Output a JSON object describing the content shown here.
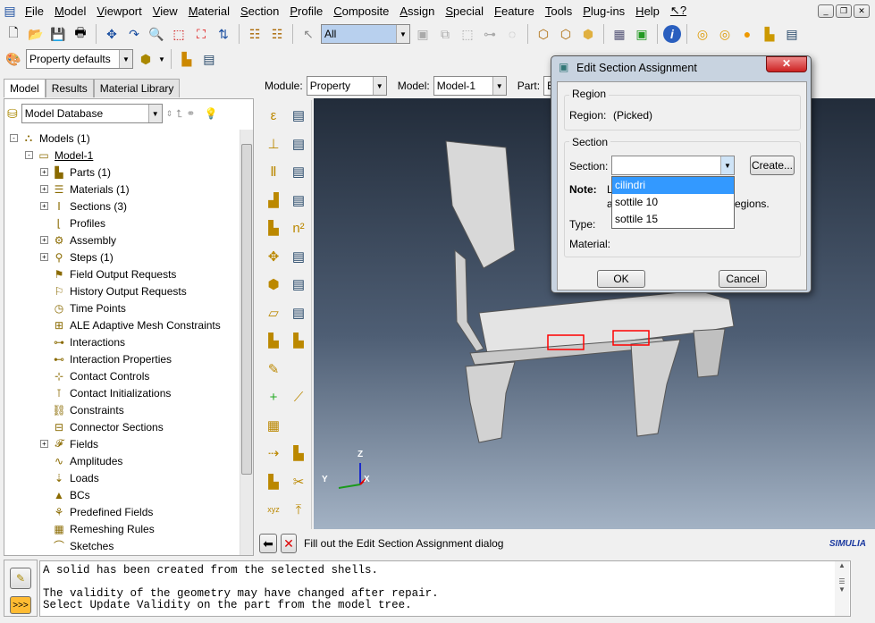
{
  "menubar": {
    "items": [
      "File",
      "Model",
      "Viewport",
      "View",
      "Material",
      "Section",
      "Profile",
      "Composite",
      "Assign",
      "Special",
      "Feature",
      "Tools",
      "Plug-ins",
      "Help"
    ],
    "help_pointer": "↖?"
  },
  "toolbar": {
    "selection_filter": "All",
    "render_style": "Property defaults"
  },
  "left_panel": {
    "tabs": [
      "Model",
      "Results",
      "Material Library"
    ],
    "database": "Model Database",
    "tree": [
      {
        "label": "Models (1)",
        "level": 0,
        "expander": "-"
      },
      {
        "label": "Model-1",
        "level": 1,
        "expander": "-"
      },
      {
        "label": "Parts (1)",
        "level": 2,
        "expander": "+"
      },
      {
        "label": "Materials (1)",
        "level": 2,
        "expander": "+"
      },
      {
        "label": "Sections (3)",
        "level": 2,
        "expander": "+"
      },
      {
        "label": "Profiles",
        "level": 2,
        "expander": ""
      },
      {
        "label": "Assembly",
        "level": 2,
        "expander": "+"
      },
      {
        "label": "Steps (1)",
        "level": 2,
        "expander": "+"
      },
      {
        "label": "Field Output Requests",
        "level": 2,
        "expander": ""
      },
      {
        "label": "History Output Requests",
        "level": 2,
        "expander": ""
      },
      {
        "label": "Time Points",
        "level": 2,
        "expander": ""
      },
      {
        "label": "ALE Adaptive Mesh Constraints",
        "level": 2,
        "expander": ""
      },
      {
        "label": "Interactions",
        "level": 2,
        "expander": ""
      },
      {
        "label": "Interaction Properties",
        "level": 2,
        "expander": ""
      },
      {
        "label": "Contact Controls",
        "level": 2,
        "expander": ""
      },
      {
        "label": "Contact Initializations",
        "level": 2,
        "expander": ""
      },
      {
        "label": "Constraints",
        "level": 2,
        "expander": ""
      },
      {
        "label": "Connector Sections",
        "level": 2,
        "expander": ""
      },
      {
        "label": "Fields",
        "level": 2,
        "expander": "+"
      },
      {
        "label": "Amplitudes",
        "level": 2,
        "expander": ""
      },
      {
        "label": "Loads",
        "level": 2,
        "expander": ""
      },
      {
        "label": "BCs",
        "level": 2,
        "expander": ""
      },
      {
        "label": "Predefined Fields",
        "level": 2,
        "expander": ""
      },
      {
        "label": "Remeshing Rules",
        "level": 2,
        "expander": ""
      },
      {
        "label": "Sketches",
        "level": 2,
        "expander": ""
      }
    ]
  },
  "context": {
    "module_label": "Module:",
    "module": "Property",
    "model_label": "Model:",
    "model": "Model-1",
    "part_label": "Part:",
    "part": "E"
  },
  "dialog": {
    "title": "Edit Section Assignment",
    "region_group": "Region",
    "region_label": "Region:",
    "region_value": "(Picked)",
    "section_group": "Section",
    "section_label": "Section:",
    "section_value": "",
    "create": "Create...",
    "note_label": "Note:",
    "note_line1": "L",
    "note_line2a": "a",
    "note_line2b": "egions.",
    "type_label": "Type:",
    "material_label": "Material:",
    "ok": "OK",
    "cancel": "Cancel",
    "dropdown": [
      "cilindri",
      "sottile 10",
      "sottile 15"
    ],
    "selected_option": "cilindri"
  },
  "prompt": {
    "text": "Fill out the Edit Section Assignment dialog"
  },
  "logo": "SIMULIA",
  "triad": {
    "x": "X",
    "y": "Y",
    "z": "Z"
  },
  "messages": [
    "A solid has been created from the selected shells.",
    "",
    "The validity of the geometry may have changed after repair.",
    "Select Update Validity on the part from the model tree."
  ],
  "colors": {
    "selection": "#3399ff",
    "viewport_top": "#222c3a",
    "viewport_bottom": "#a3b2c4",
    "highlight": "#ff0000"
  }
}
